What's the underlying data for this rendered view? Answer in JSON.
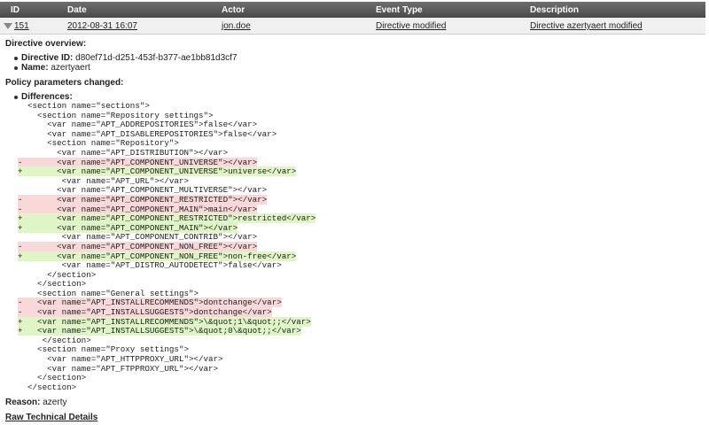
{
  "table": {
    "headers": [
      "ID",
      "Date",
      "Actor",
      "Event Type",
      "Description"
    ],
    "row": {
      "id": "151",
      "date": "2012-08-31 16:07",
      "actor": "jon.doe",
      "event_type": "Directive modified",
      "description": "Directive azertyaert modified"
    }
  },
  "overview": {
    "title": "Directive overview:",
    "directive_id_label": "Directive ID:",
    "directive_id": "d80ef71d-d251-453f-b377-ae1bb81d3cf7",
    "name_label": "Name:",
    "name": "azertyaert"
  },
  "params": {
    "title": "Policy parameters changed:",
    "differences_label": "Differences:"
  },
  "diff_lines": [
    {
      "k": " ",
      "t": "  <section name=\"sections\">"
    },
    {
      "k": " ",
      "t": "    <section name=\"Repository settings\">"
    },
    {
      "k": " ",
      "t": "      <var name=\"APT_ADDREPOSITORIES\">false</var>"
    },
    {
      "k": " ",
      "t": "      <var name=\"APT_DISABLEREPOSITORIES\">false</var>"
    },
    {
      "k": " ",
      "t": "      <section name=\"Repository\">"
    },
    {
      "k": " ",
      "t": "        <var name=\"APT_DISTRIBUTION\"></var>"
    },
    {
      "k": "-",
      "t": "        <var name=\"APT_COMPONENT_UNIVERSE\"></var>"
    },
    {
      "k": "+",
      "t": "        <var name=\"APT_COMPONENT_UNIVERSE\">universe</var>"
    },
    {
      "k": " ",
      "t": "         <var name=\"APT_URL\"></var>"
    },
    {
      "k": " ",
      "t": "        <var name=\"APT_COMPONENT_MULTIVERSE\"></var>"
    },
    {
      "k": "-",
      "t": "        <var name=\"APT_COMPONENT_RESTRICTED\"></var>"
    },
    {
      "k": "-",
      "t": "        <var name=\"APT_COMPONENT_MAIN\">main</var>"
    },
    {
      "k": "+",
      "t": "        <var name=\"APT_COMPONENT_RESTRICTED\">restricted</var>"
    },
    {
      "k": "+",
      "t": "        <var name=\"APT_COMPONENT_MAIN\"></var>"
    },
    {
      "k": " ",
      "t": "         <var name=\"APT_COMPONENT_CONTRIB\"></var>"
    },
    {
      "k": "-",
      "t": "        <var name=\"APT_COMPONENT_NON_FREE\"></var>"
    },
    {
      "k": "+",
      "t": "        <var name=\"APT_COMPONENT_NON_FREE\">non-free</var>"
    },
    {
      "k": " ",
      "t": "         <var name=\"APT_DISTRO_AUTODETECT\">false</var>"
    },
    {
      "k": " ",
      "t": "      </section>"
    },
    {
      "k": " ",
      "t": "    </section>"
    },
    {
      "k": " ",
      "t": "    <section name=\"General settings\">"
    },
    {
      "k": "-",
      "t": "    <var name=\"APT_INSTALLRECOMMENDS\">dontchange</var>"
    },
    {
      "k": "-",
      "t": "    <var name=\"APT_INSTALLSUGGESTS\">dontchange</var>"
    },
    {
      "k": "+",
      "t": "    <var name=\"APT_INSTALLRECOMMENDS\">\\&quot;1\\&quot;;</var>"
    },
    {
      "k": "+",
      "t": "    <var name=\"APT_INSTALLSUGGESTS\">\\&quot;0\\&quot;;</var>"
    },
    {
      "k": " ",
      "t": "     </section>"
    },
    {
      "k": " ",
      "t": "    <section name=\"Proxy settings\">"
    },
    {
      "k": " ",
      "t": "      <var name=\"APT_HTTPPROXY_URL\"></var>"
    },
    {
      "k": " ",
      "t": "      <var name=\"APT_FTPPROXY_URL\"></var>"
    },
    {
      "k": " ",
      "t": "    </section>"
    },
    {
      "k": " ",
      "t": "  </section>"
    }
  ],
  "reason": {
    "label": "Reason:",
    "value": "azerty"
  },
  "raw_link": "Raw Technical Details"
}
